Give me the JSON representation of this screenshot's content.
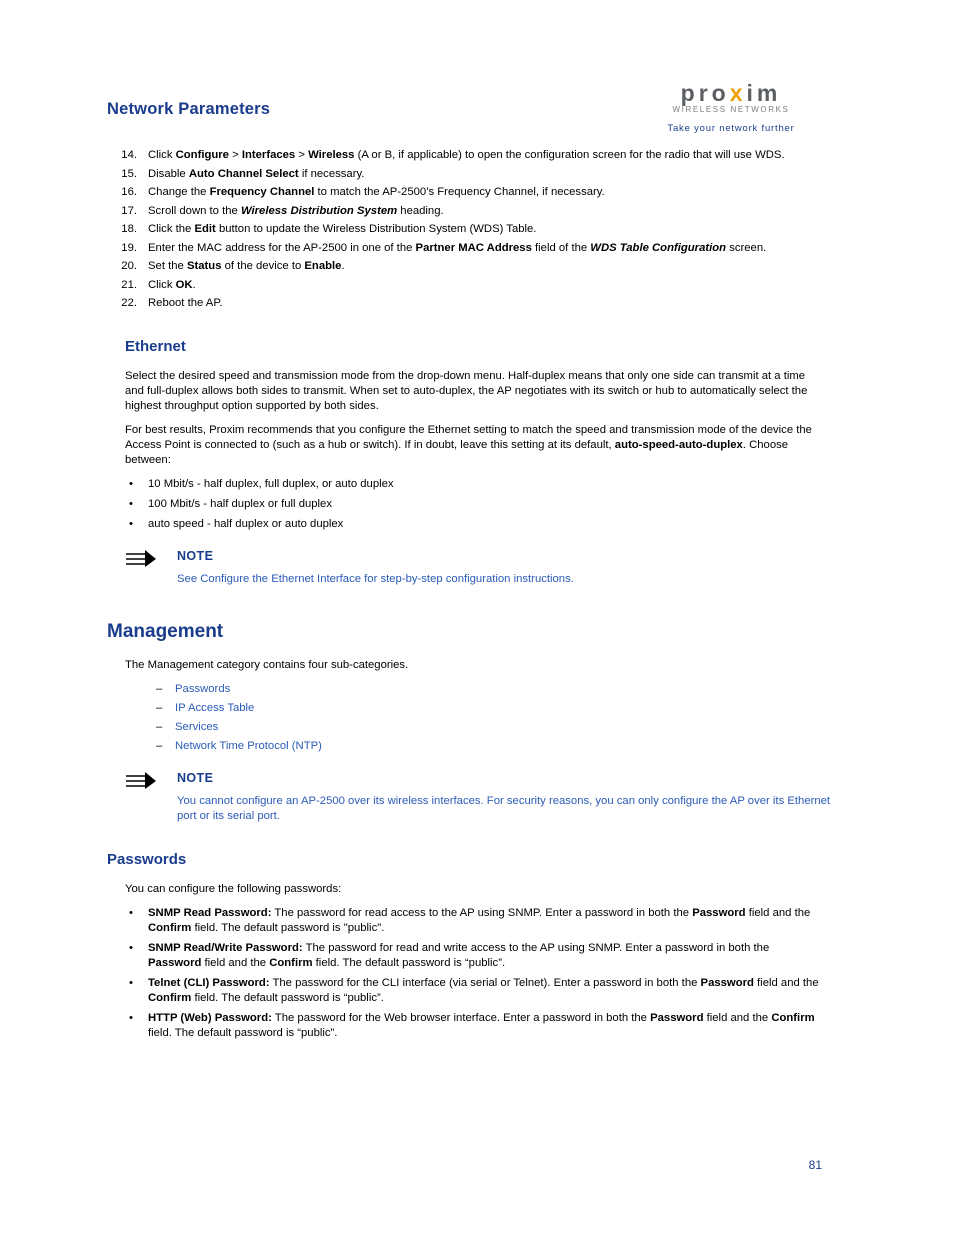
{
  "header": {
    "chapter_title": "Network Parameters",
    "logo": {
      "word_pre": "pro",
      "word_x": "x",
      "word_post": "im",
      "subtitle": "WIRELESS NETWORKS",
      "tagline": "Take your network further"
    }
  },
  "steps": [
    {
      "num": "14.",
      "html": "Click <b>Configure</b> &gt; <b>Interfaces</b> &gt; <b>Wireless</b> (A or B, if applicable) to open the configuration screen for the radio that will use WDS."
    },
    {
      "num": "15.",
      "html": "Disable <b>Auto Channel Select</b> if necessary."
    },
    {
      "num": "16.",
      "html": "Change the <b>Frequency Channel</b> to match the AP-2500&rsquo;s Frequency Channel, if necessary."
    },
    {
      "num": "17.",
      "html": "Scroll down to the <span class=\"bi\">Wireless Distribution System</span> heading."
    },
    {
      "num": "18.",
      "html": "Click the <b>Edit</b> button to update the Wireless Distribution System (WDS) Table."
    },
    {
      "num": "19.",
      "html": "Enter the MAC address for the AP-2500 in one of the <b>Partner MAC Address</b> field of the <span class=\"bi\">WDS Table Configuration</span> screen."
    },
    {
      "num": "20.",
      "html": "Set the <b>Status</b> of the device to <b>Enable</b>."
    },
    {
      "num": "21.",
      "html": "Click <b>OK</b>."
    },
    {
      "num": "22.",
      "html": "Reboot the AP."
    }
  ],
  "ethernet": {
    "heading": "Ethernet",
    "para1": "Select the desired speed and transmission mode from the drop-down menu. Half-duplex means that only one side can transmit at a time and full-duplex allows both sides to transmit. When set to auto-duplex, the AP negotiates with its switch or hub to automatically select the highest throughput option supported by both sides.",
    "para2_html": "For best results, Proxim recommends that you configure the Ethernet setting to match the speed and transmission mode of the device the Access Point is connected to (such as a hub or switch). If in doubt, leave this setting at its default, <b>auto-speed-auto-duplex</b>. Choose between:",
    "bullets": [
      "10 Mbit/s - half duplex, full duplex, or auto duplex",
      "100 Mbit/s - half duplex or full duplex",
      "auto speed - half duplex or auto duplex"
    ],
    "note": {
      "title": "NOTE",
      "body_html": "See <span class=\"link\">Configure the Ethernet Interface</span> for step-by-step configuration instructions."
    }
  },
  "management": {
    "heading": "Management",
    "intro": "The Management category contains four sub-categories.",
    "subcategories": [
      "Passwords",
      "IP Access Table",
      "Services",
      "Network Time Protocol (NTP)"
    ],
    "note": {
      "title": "NOTE",
      "body": "You cannot configure an AP-2500 over its wireless interfaces. For security reasons, you can only configure the AP over its Ethernet port or its serial port."
    }
  },
  "passwords": {
    "heading": "Passwords",
    "intro": "You can configure the following passwords:",
    "items": [
      "<b>SNMP Read Password:</b> The password for read access to the AP using SNMP. Enter a password in both the <b>Password</b> field and the <b>Confirm</b> field. The default password is \"public\".",
      "<b>SNMP Read/Write Password:</b> The password for read and write access to the AP using SNMP. Enter a password in both the <b>Password</b> field and the <b>Confirm</b> field. The default password is “public”.",
      "<b>Telnet (CLI) Password:</b> The password for the CLI interface (via serial or Telnet). Enter a password in both the <b>Password</b> field and the <b>Confirm</b> field. The default password is “public”.",
      "<b>HTTP (Web) Password:</b> The password for the Web browser interface. Enter a password in both the <b>Password</b> field and the <b>Confirm</b> field. The default password is “public”."
    ]
  },
  "footer": {
    "page_number": "81"
  }
}
